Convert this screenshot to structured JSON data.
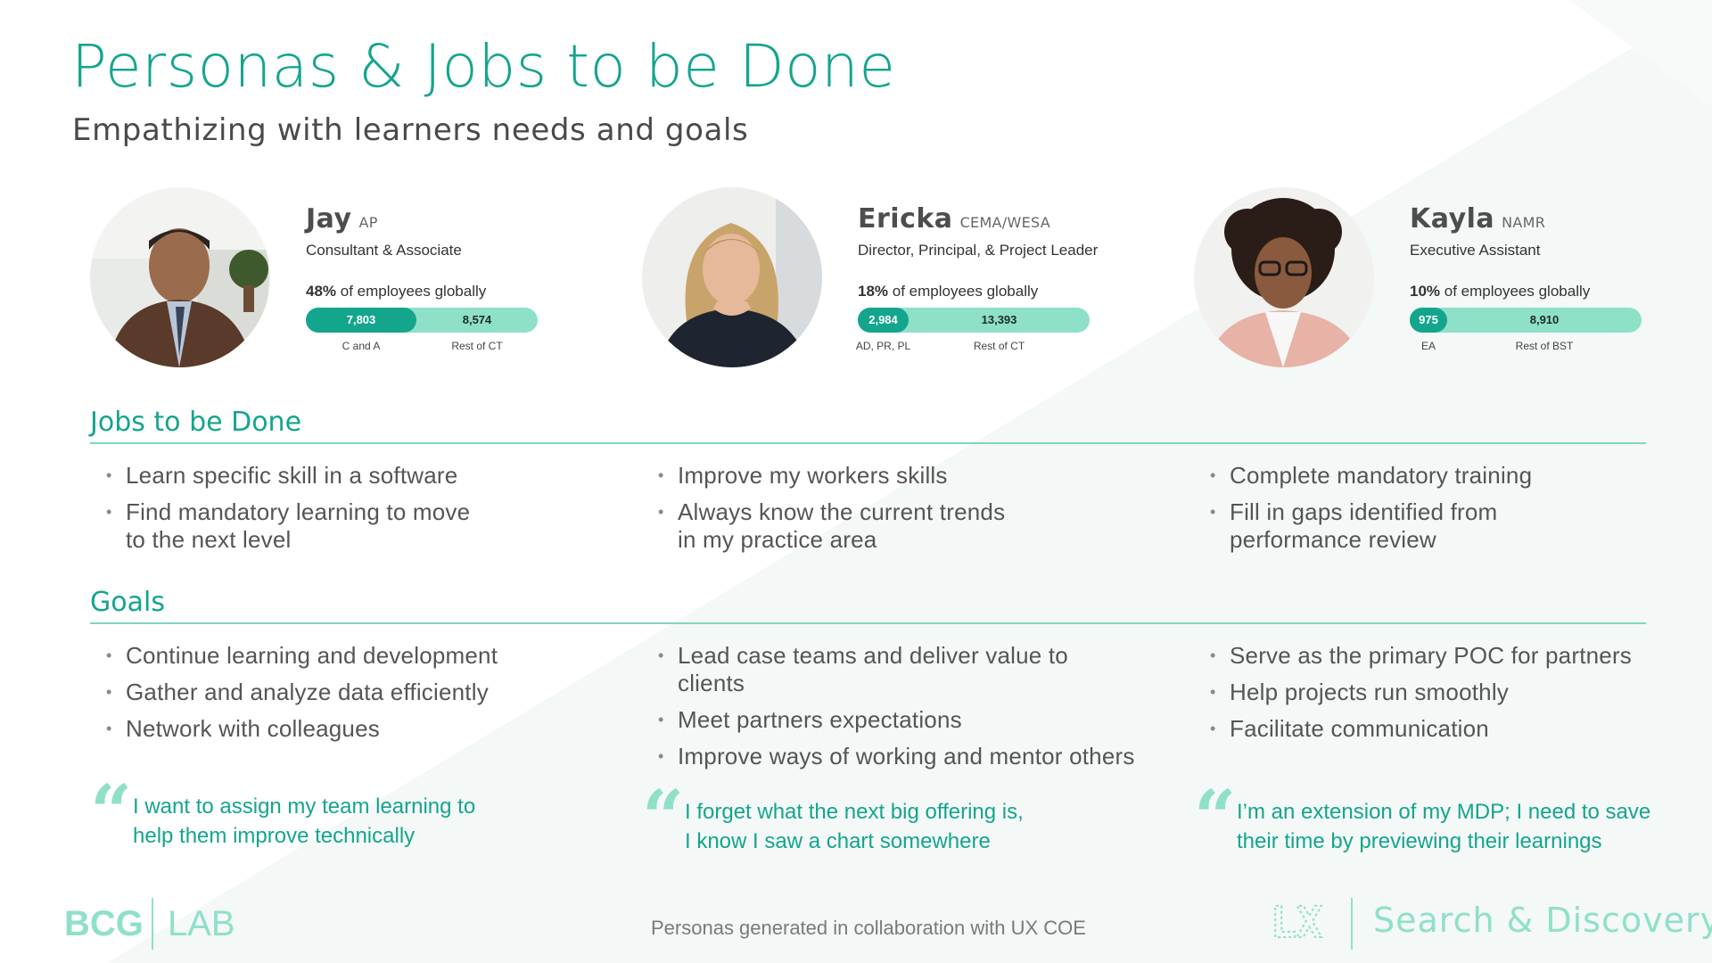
{
  "header": {
    "title": "Personas & Jobs to be Done",
    "subtitle": "Empathizing with learners needs and goals"
  },
  "personas": [
    {
      "name": "Jay",
      "region": "AP",
      "role": "Consultant & Associate",
      "percent": "48%",
      "percent_suffix": "of employees globally",
      "bar": {
        "left_value": "7,803",
        "right_value": "8,574",
        "left_fraction": 0.476,
        "left_caption": "C and A",
        "right_caption": "Rest of CT"
      }
    },
    {
      "name": "Ericka",
      "region": "CEMA/WESA",
      "role": "Director, Principal, & Project Leader",
      "percent": "18%",
      "percent_suffix": "of employees globally",
      "bar": {
        "left_value": "2,984",
        "right_value": "13,393",
        "left_fraction": 0.22,
        "left_caption": "AD, PR, PL",
        "right_caption": "Rest of CT"
      }
    },
    {
      "name": "Kayla",
      "region": "NAMR",
      "role": "Executive Assistant",
      "percent": "10%",
      "percent_suffix": "of employees globally",
      "bar": {
        "left_value": "975",
        "right_value": "8,910",
        "left_fraction": 0.16,
        "left_caption": "EA",
        "right_caption": "Rest of BST"
      }
    }
  ],
  "jobs": {
    "title": "Jobs to be Done",
    "columns": [
      [
        "Learn specific skill in a software",
        "Find mandatory learning to move\nto the next level"
      ],
      [
        "Improve my workers skills",
        "Always know the current trends\nin my practice area"
      ],
      [
        "Complete mandatory training",
        "Fill in gaps identified from\nperformance review"
      ]
    ]
  },
  "goals": {
    "title": "Goals",
    "columns": [
      [
        "Continue learning and development",
        "Gather and analyze data efficiently",
        "Network with colleagues"
      ],
      [
        "Lead case teams and deliver value to clients",
        "Meet partners expectations",
        "Improve ways of working and mentor others"
      ],
      [
        "Serve as the primary POC for partners",
        "Help projects run smoothly",
        "Facilitate communication"
      ]
    ]
  },
  "quotes": [
    "I want to assign my team learning to\nhelp them improve technically",
    "I forget what the next big offering is,\nI know I saw a chart somewhere",
    "I’m an extension of my MDP; I need to save\ntheir time by previewing their learnings"
  ],
  "footer": {
    "logo_left_a": "BCG",
    "logo_left_b": "LAB",
    "note": "Personas generated in collaboration with UX COE",
    "logo_right": "LX",
    "product": "Search & Discovery"
  },
  "colors": {
    "accent": "#14a58d",
    "accent_light": "#8fe0c9",
    "text": "#555555"
  }
}
